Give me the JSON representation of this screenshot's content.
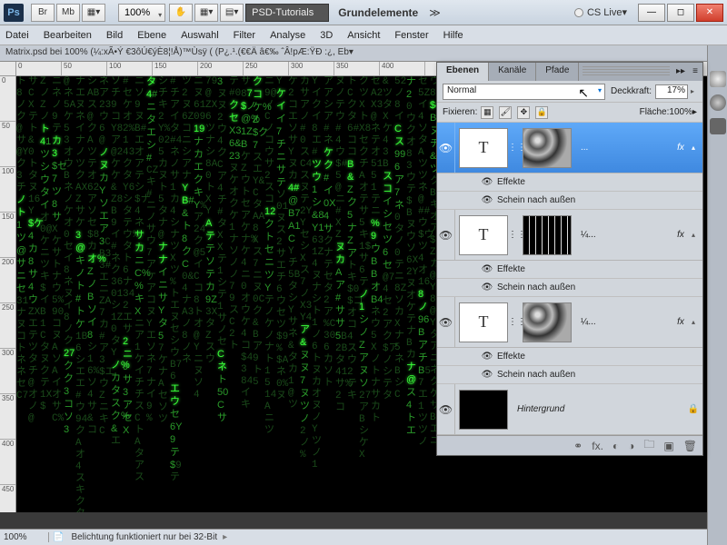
{
  "titlebar": {
    "br": "Br",
    "mb": "Mb",
    "zoom": "100%",
    "psd_tutorials": "PSD-Tutorials",
    "grundelemente": "Grundelemente",
    "cslive": "CS Live"
  },
  "menu": {
    "datei": "Datei",
    "bearbeiten": "Bearbeiten",
    "bild": "Bild",
    "ebene": "Ebene",
    "auswahl": "Auswahl",
    "filter": "Filter",
    "analyse": "Analyse",
    "drei_d": "3D",
    "ansicht": "Ansicht",
    "fenster": "Fenster",
    "hilfe": "Hilfe"
  },
  "doc": {
    "tab": "Matrix.psd bei 100% (¼:xÃ•Ý €3ôÚ€ýÈ8¦!Å)™Ùsÿ      (  (P¿.¹.(€€Ä â€‰ ˆÂ!pÆ:ŸÐ :¿, Eb▾",
    "status_zoom": "100%",
    "status_msg": "Belichtung funktioniert nur bei 32-Bit"
  },
  "panel": {
    "tabs": {
      "ebenen": "Ebenen",
      "kanale": "Kanäle",
      "pfade": "Pfade"
    },
    "mode": "Normal",
    "deckkraft_lbl": "Deckkraft:",
    "deckkraft": "17%",
    "fixieren": "Fixieren:",
    "flache_lbl": "Fläche:",
    "flache": "100%",
    "effekte": "Effekte",
    "schein": "Schein nach außen",
    "layer1_name": "...",
    "layer2_name": "¼...",
    "layer3_name": "¼...",
    "bg_name": "Hintergrund",
    "fx": "fx",
    "T": "T"
  },
  "ruler_h": [
    "0",
    "50",
    "100",
    "150",
    "200",
    "250",
    "300",
    "350",
    "400"
  ],
  "ruler_v": [
    "0",
    "50",
    "100",
    "150",
    "200",
    "250",
    "300",
    "350",
    "400",
    "450"
  ]
}
